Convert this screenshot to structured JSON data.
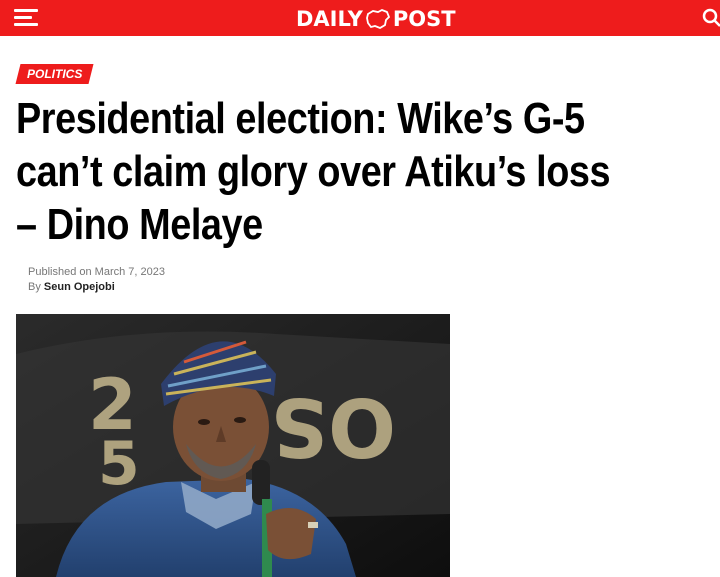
{
  "header": {
    "logo_left": "DAILY",
    "logo_right": "POST",
    "menu_icon": "hamburger-menu-icon",
    "search_icon": "search-icon",
    "brand_color": "#ee1c1c"
  },
  "article": {
    "category": "POLITICS",
    "title": "Presidential election: Wike’s G-5 can’t claim glory over Atiku’s loss – Dino Melaye",
    "published_label": "Published on",
    "published_date": "March 7, 2023",
    "by_label": "By",
    "author": "Seun Opejobi"
  }
}
